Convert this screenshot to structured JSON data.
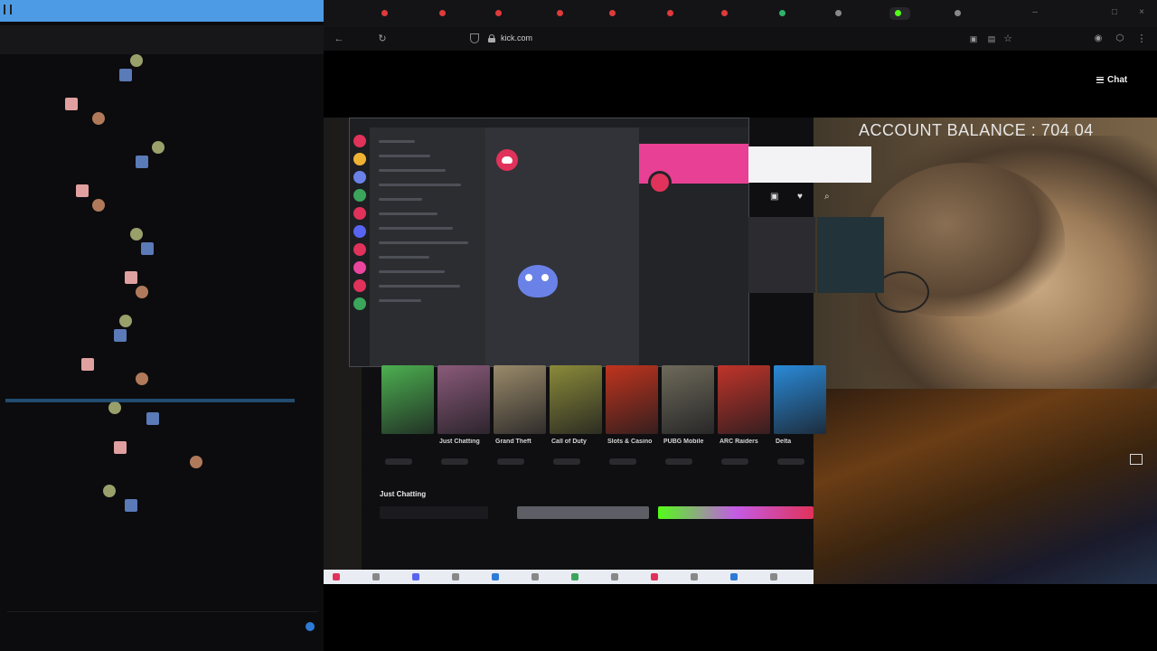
{
  "chat": {
    "pinned_line1": "",
    "pinned_line2": "",
    "messages": [
      {
        "user": "",
        "text": "",
        "user_color": "#c9c9c9"
      },
      {
        "user": "",
        "text": "",
        "user_color": "#7fb26f"
      },
      {
        "user": "",
        "text": "",
        "user_color": "#7fb26f"
      },
      {
        "user": "",
        "text": "",
        "user_color": "#c9c9c9"
      },
      {
        "user": "",
        "text": "",
        "user_color": "#c9c9c9"
      },
      {
        "user": "",
        "text": "",
        "user_color": "#c9c9c9"
      },
      {
        "user": "",
        "text": "",
        "user_color": "#c9c9c9"
      },
      {
        "user": "",
        "text": "",
        "user_color": "#a9d86a"
      },
      {
        "user": "",
        "text": "",
        "user_color": "#6fb0ff"
      },
      {
        "user": "",
        "text": "",
        "user_color": "#c9c9c9"
      },
      {
        "user": "",
        "text": "",
        "user_color": "#6fb0ff"
      },
      {
        "user": "",
        "text": "",
        "user_color": "#c9c9c9"
      },
      {
        "user": "",
        "text": "",
        "user_color": "#c9c9c9"
      },
      {
        "user": "",
        "text": "",
        "user_color": "#c9c9c9"
      },
      {
        "user": "",
        "text": "",
        "user_color": "#6fb0ff"
      },
      {
        "user": "",
        "text": "",
        "user_color": "#c9c9c9"
      },
      {
        "user": "",
        "text": "",
        "user_color": "#c9c9c9"
      },
      {
        "user": "",
        "text": "",
        "user_color": "#c9c9c9"
      },
      {
        "user": "",
        "text": "",
        "user_color": "#9ad17d"
      },
      {
        "user": "",
        "text": "",
        "user_color": "#c9c9c9"
      },
      {
        "user": "",
        "text": "",
        "user_color": "#c9c9c9"
      },
      {
        "user": "",
        "text": "",
        "user_color": "#c9c9c9"
      },
      {
        "user": "",
        "text": "",
        "user_color": "#c9c9c9"
      },
      {
        "user": "",
        "text": "",
        "user_color": "#c9c9c9"
      },
      {
        "user": "",
        "text": "",
        "user_color": "#c9c9c9"
      },
      {
        "user": "",
        "text": "",
        "user_color": "#e06a3a"
      },
      {
        "user": "",
        "text": "",
        "user_color": "#c9c9c9"
      },
      {
        "user": "",
        "text": "",
        "user_color": "#c9c9c9"
      },
      {
        "user": "",
        "text": "",
        "user_color": "#c9c9c9"
      },
      {
        "user": "",
        "text": "",
        "user_color": "#c9c9c9"
      },
      {
        "user": "",
        "text": "",
        "user_color": "#c9c9c9"
      },
      {
        "user": "",
        "text": "",
        "user_color": "#c9c9c9"
      }
    ]
  },
  "browser": {
    "tabs": [
      {
        "label": "",
        "color": "#e03a3a"
      },
      {
        "label": "",
        "color": "#e03a3a"
      },
      {
        "label": "",
        "color": "#e03a3a"
      },
      {
        "label": "",
        "color": "#e03a3a"
      },
      {
        "label": "",
        "color": "#e03a3a"
      },
      {
        "label": "",
        "color": "#e03a3a"
      },
      {
        "label": "",
        "color": "#e03a3a"
      },
      {
        "label": "",
        "color": "#2fb36a"
      },
      {
        "label": "",
        "color": "#888888"
      },
      {
        "label": "",
        "color": "#53fc18"
      },
      {
        "label": "",
        "color": "#888888"
      }
    ],
    "url": "kick.com",
    "url_path": "",
    "back_icon": "arrow-left",
    "reload_icon": "reload"
  },
  "page": {
    "chat_button": "Chat",
    "balance_overlay": "ACCOUNT BALANCE : 704 04",
    "discord_username": "",
    "section_title": "Just Chatting",
    "categories": [
      {
        "name": "",
        "color": "#4caf50"
      },
      {
        "name": "Just Chatting",
        "color": "#8a5a7a"
      },
      {
        "name": "Grand Theft",
        "color": "#9a8a6a"
      },
      {
        "name": "Call of Duty",
        "color": "#8a8a3a"
      },
      {
        "name": "Slots & Casino",
        "color": "#c0341e"
      },
      {
        "name": "PUBG Mobile",
        "color": "#6e6a5a"
      },
      {
        "name": "ARC Raiders",
        "color": "#c0342a"
      },
      {
        "name": "Delta",
        "color": "#2a8ad8"
      }
    ]
  },
  "colors": {
    "kick_green": "#53fc18",
    "discord_blurple": "#6a82e8",
    "discord_pink": "#e74094",
    "chat_topbar": "#4d9be4"
  }
}
